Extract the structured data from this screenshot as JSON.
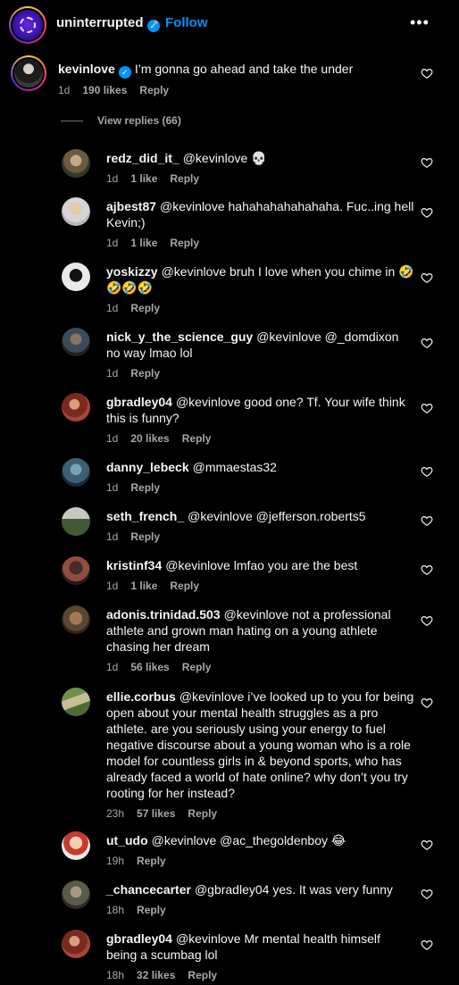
{
  "header": {
    "username": "uninterrupted",
    "dot": "•",
    "follow_label": "Follow",
    "more_label": "•••"
  },
  "main_comment": {
    "username": "kevinlove",
    "text": "I’m gonna go ahead and take the under",
    "time": "1d",
    "likes": "190 likes",
    "reply_label": "Reply"
  },
  "view_replies_label": "View replies (66)",
  "replies": [
    {
      "username": "redz_did_it_",
      "text": "@kevinlove 💀",
      "time": "1d",
      "likes": "1 like",
      "reply_label": "Reply"
    },
    {
      "username": "ajbest87",
      "text": "@kevinlove hahahahahahahaha. Fuc..ing hell Kevin;)",
      "time": "1d",
      "likes": "1 like",
      "reply_label": "Reply"
    },
    {
      "username": "yoskizzy",
      "text": "@kevinlove bruh I love when you chime in 🤣🤣🤣🤣",
      "time": "1d",
      "likes": "",
      "reply_label": "Reply"
    },
    {
      "username": "nick_y_the_science_guy",
      "text": "@kevinlove @_domdixon no way lmao lol",
      "time": "1d",
      "likes": "",
      "reply_label": "Reply"
    },
    {
      "username": "gbradley04",
      "text": "@kevinlove good one? Tf. Your wife think this is funny?",
      "time": "1d",
      "likes": "20 likes",
      "reply_label": "Reply"
    },
    {
      "username": "danny_lebeck",
      "text": "@mmaestas32",
      "time": "1d",
      "likes": "",
      "reply_label": "Reply"
    },
    {
      "username": "seth_french_",
      "text": "@kevinlove @jefferson.roberts5",
      "time": "1d",
      "likes": "",
      "reply_label": "Reply"
    },
    {
      "username": "kristinf34",
      "text": "@kevinlove lmfao you are the best",
      "time": "1d",
      "likes": "1 like",
      "reply_label": "Reply"
    },
    {
      "username": "adonis.trinidad.503",
      "text": "@kevinlove not a professional athlete and grown man hating on a young athlete chasing her dream",
      "time": "1d",
      "likes": "56 likes",
      "reply_label": "Reply"
    },
    {
      "username": "ellie.corbus",
      "text": "@kevinlove i’ve looked up to you for being open about your mental health struggles as a pro athlete. are you seriously using your energy to fuel negative discourse about a young woman who is a role model for countless girls in & beyond sports, who has already faced a world of hate online? why don’t you try rooting for her instead?",
      "time": "23h",
      "likes": "57 likes",
      "reply_label": "Reply"
    },
    {
      "username": "ut_udo",
      "text": "@kevinlove @ac_thegoldenboy 😂",
      "time": "19h",
      "likes": "",
      "reply_label": "Reply"
    },
    {
      "username": "_chancecarter",
      "text": "@gbradley04 yes. It was very funny",
      "time": "18h",
      "likes": "",
      "reply_label": "Reply"
    },
    {
      "username": "gbradley04",
      "text": "@kevinlove Mr mental health himself being a scumbag lol",
      "time": "18h",
      "likes": "32 likes",
      "reply_label": "Reply"
    }
  ],
  "colors": {
    "background": "#000000",
    "text": "#f5f5f5",
    "muted": "#a8a8a8",
    "link": "#0095f6"
  }
}
